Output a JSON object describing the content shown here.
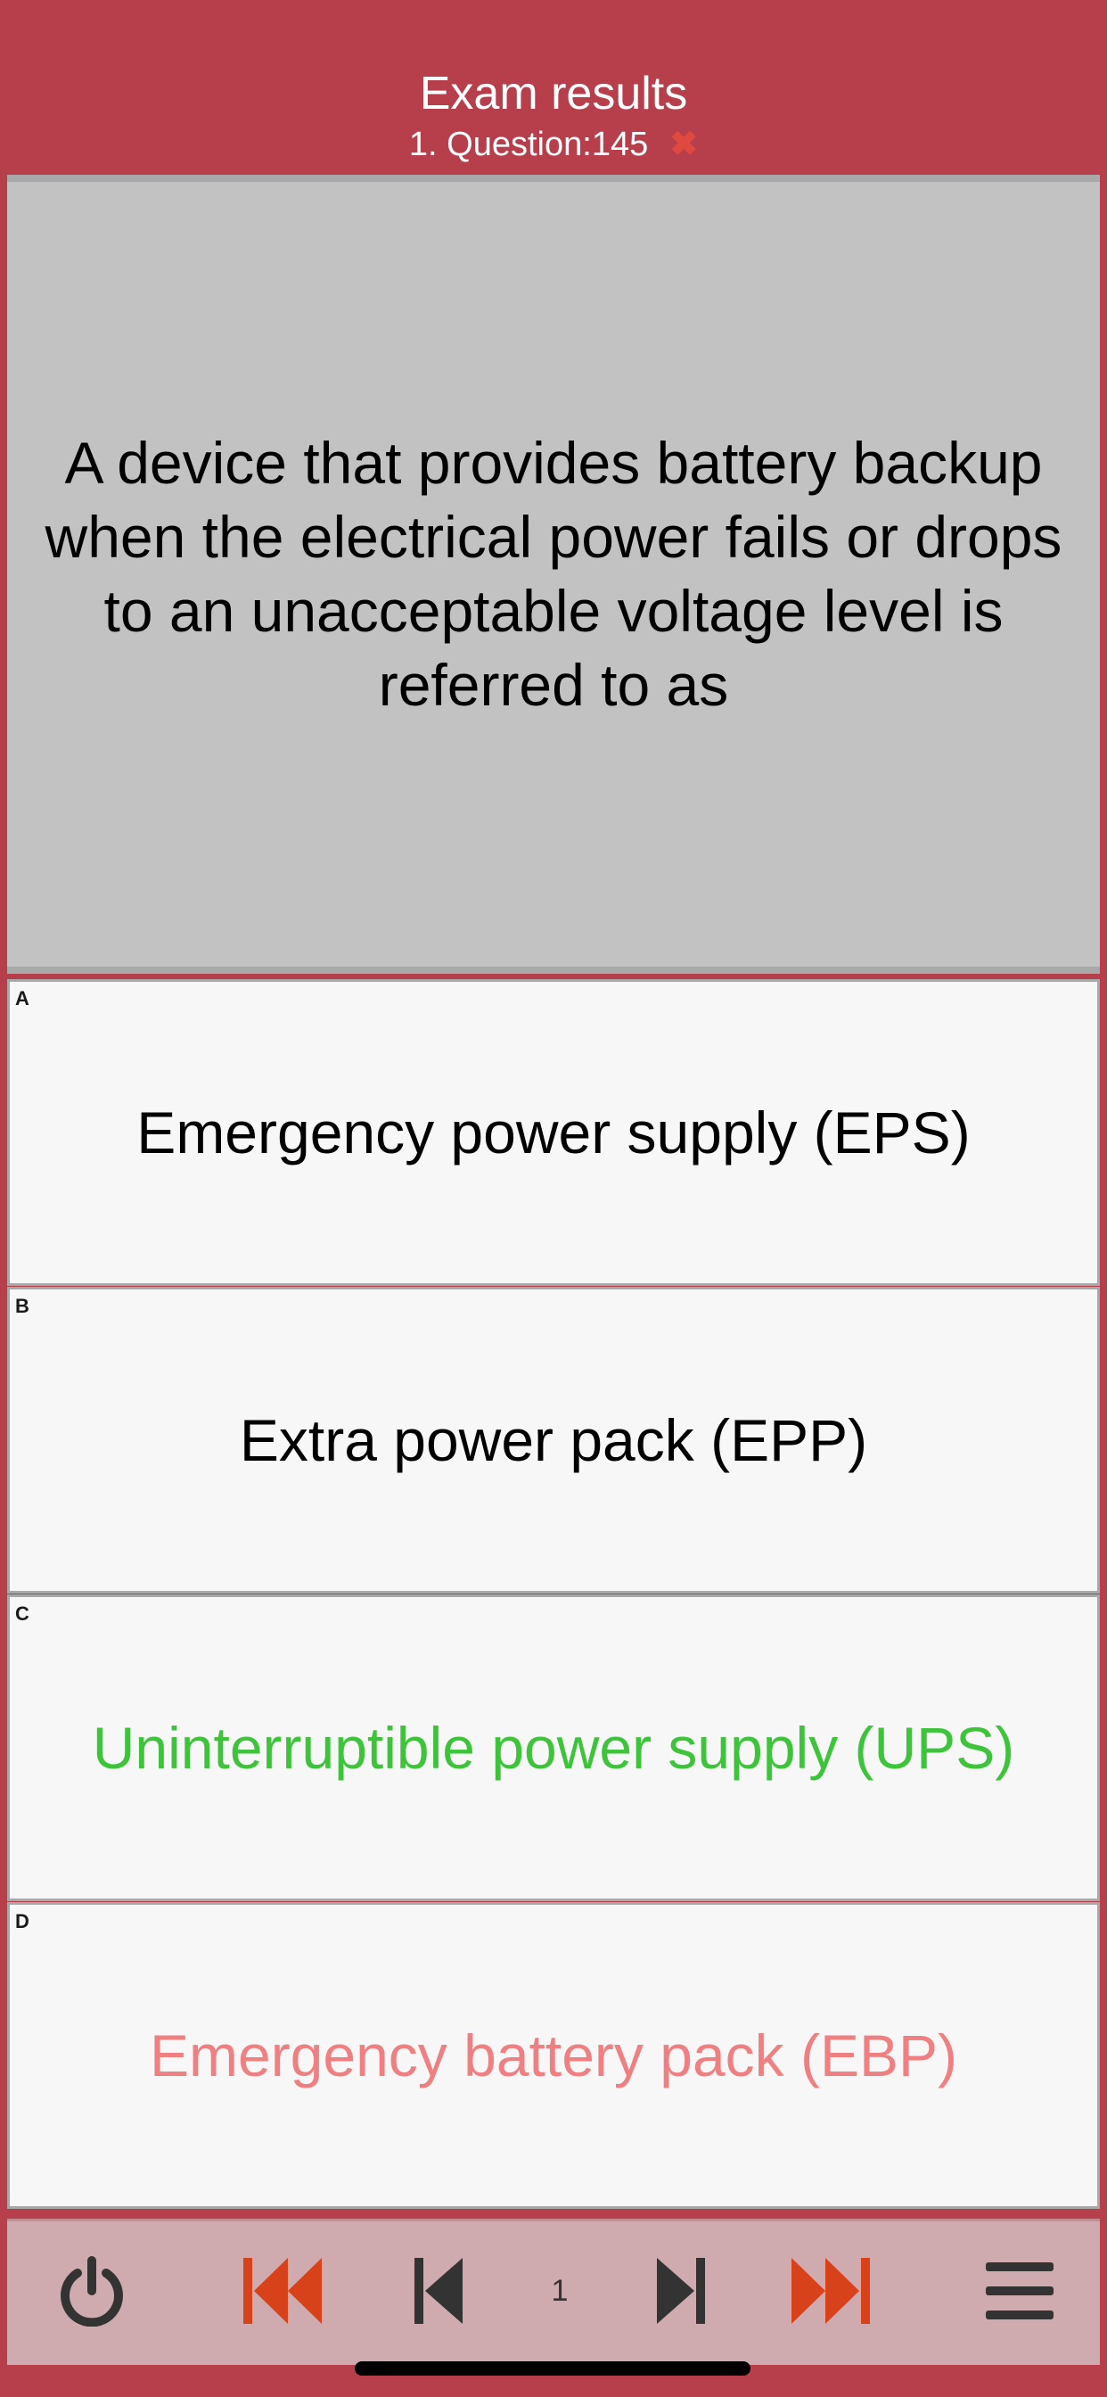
{
  "header": {
    "title": "Exam results",
    "subtitle": "1. Question:145",
    "wrong_mark": "✖"
  },
  "question": {
    "text": "A device that provides battery backup when the electrical power fails or drops to an unacceptable voltage level is referred to as"
  },
  "answers": [
    {
      "letter": "A",
      "text": "Emergency power supply (EPS)",
      "color": "#000000",
      "state": "neutral"
    },
    {
      "letter": "B",
      "text": "Extra power pack (EPP)",
      "color": "#000000",
      "state": "neutral"
    },
    {
      "letter": "C",
      "text": "Uninterruptible power supply (UPS)",
      "color": "#3ec43a",
      "state": "correct"
    },
    {
      "letter": "D",
      "text": "Emergency battery pack (EBP)",
      "color": "#f07f82",
      "state": "wrong"
    }
  ],
  "nav": {
    "page": "1",
    "icons": [
      "power-icon",
      "first-icon",
      "prev-icon",
      "next-icon",
      "last-icon",
      "menu-icon"
    ],
    "colors": {
      "dark": "#333333",
      "accent": "#d8421b"
    }
  }
}
